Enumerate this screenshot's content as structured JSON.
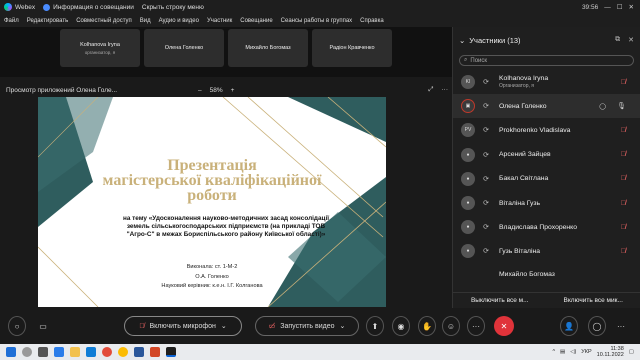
{
  "titlebar": {
    "app_name": "Webex",
    "meeting_info": "Информация о совещании",
    "hide_menu": "Скрыть строку меню",
    "time": "39:56"
  },
  "menu": [
    "Файл",
    "Редактировать",
    "Совместный доступ",
    "Вид",
    "Аудио и видео",
    "Участник",
    "Совещание",
    "Сеансы работы в группах",
    "Справка"
  ],
  "video_tiles": [
    {
      "name": "Kolhanova Iryna",
      "sub": "организатор, я"
    },
    {
      "name": "Олена Голенко",
      "sub": ""
    },
    {
      "name": "Михайло Богомаз",
      "sub": ""
    },
    {
      "name": "Радіон Кравченко",
      "sub": ""
    }
  ],
  "share": {
    "label": "Просмотр приложений Олена Голе...",
    "zoom_out": "–",
    "zoom": "58%",
    "zoom_in": "+"
  },
  "slide": {
    "title_line1": "Презентація",
    "title_line2": "магістерської кваліфікаційної",
    "title_line3": "роботи",
    "sub1": "на тему «Удосконалення науково-методичних засад консолідації",
    "sub2": "земель сільськогосподарських підприємств (на прикладі ТОВ",
    "sub3": "\"Агро-С\" в межах Бориспільського району Київської області)»",
    "author1": "Виконала: ст. 1-М-2",
    "author2": "О.А. Голенко",
    "author3": "Науковий керівник: к.е.н. І.Г. Колганова"
  },
  "participants": {
    "header": "Участники (13)",
    "search_placeholder": "Поиск",
    "list": [
      {
        "initials": "KI",
        "name": "Kolhanova Iryna",
        "role": "Организатор, я",
        "mic": "muted",
        "chat": false
      },
      {
        "initials": "",
        "name": "Олена Голенко",
        "role": "",
        "mic": "on",
        "chat": true
      },
      {
        "initials": "PV",
        "name": "Prokhorenko Vladislava",
        "role": "",
        "mic": "muted",
        "chat": false
      },
      {
        "initials": "",
        "name": "Арсений Зайцев",
        "role": "",
        "mic": "muted",
        "chat": false
      },
      {
        "initials": "",
        "name": "Бакал Світлана",
        "role": "",
        "mic": "muted",
        "chat": false
      },
      {
        "initials": "",
        "name": "Віталіна Гузь",
        "role": "",
        "mic": "muted",
        "chat": false
      },
      {
        "initials": "",
        "name": "Владислава Прохоренко",
        "role": "",
        "mic": "muted",
        "chat": false
      },
      {
        "initials": "",
        "name": "Гузь Віталіна",
        "role": "",
        "mic": "muted",
        "chat": false
      },
      {
        "initials": "",
        "name": "Михайло Богомаз",
        "role": "",
        "mic": "muted",
        "chat": false
      }
    ],
    "mute_all": "Выключить все м...",
    "unmute_all": "Включить все мик..."
  },
  "controls": {
    "mic_label": "Включить микрофон",
    "video_label": "Запустить видео"
  },
  "taskbar": {
    "lang": "УКР",
    "time": "11:38",
    "date": "10.11.2022"
  },
  "colors": {
    "accent_teal": "#2f5d5e",
    "gold": "#c9b17a",
    "muted_red": "#ff6b6b",
    "end_call": "#e0333a"
  }
}
